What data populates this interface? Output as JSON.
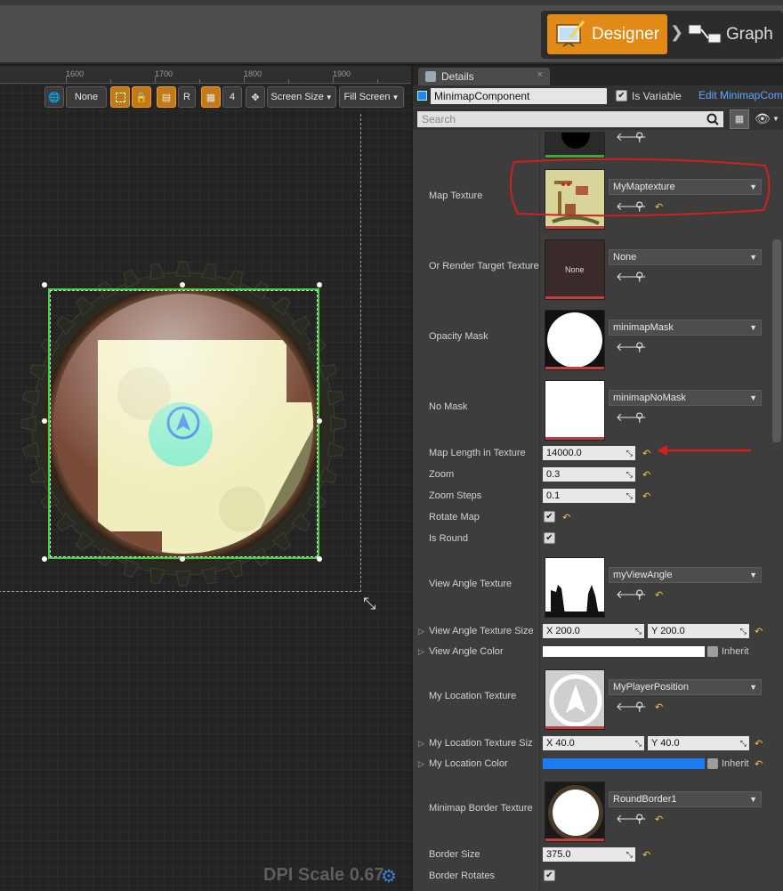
{
  "header": {
    "designer_label": "Designer",
    "graph_label": "Graph"
  },
  "ruler": {
    "ticks": [
      "1600",
      "1700",
      "1800",
      "1900"
    ]
  },
  "toolbar": {
    "none_label": "None",
    "r_label": "R",
    "grid_value": "4",
    "screen_size_label": "Screen Size",
    "fill_screen_label": "Fill Screen"
  },
  "canvas": {
    "dpi_label": "DPI Scale 0.67"
  },
  "details": {
    "tab_label": "Details",
    "tab_close": "×",
    "component_name": "MinimapComponent",
    "is_variable_label": "Is Variable",
    "edit_link": "Edit MinimapCom",
    "search_placeholder": "Search",
    "none_thumb_text": "None",
    "inherit_label": "Inherit",
    "properties": {
      "map_texture": {
        "label": "Map Texture",
        "value": "MyMaptexture"
      },
      "render_target": {
        "label": "Or Render Target Texture",
        "value": "None"
      },
      "opacity_mask": {
        "label": "Opacity Mask",
        "value": "minimapMask"
      },
      "no_mask": {
        "label": "No Mask",
        "value": "minimapNoMask"
      },
      "map_length": {
        "label": "Map Length in Texture",
        "value": "14000.0"
      },
      "zoom": {
        "label": "Zoom",
        "value": "0.3"
      },
      "zoom_steps": {
        "label": "Zoom Steps",
        "value": "0.1"
      },
      "rotate_map": {
        "label": "Rotate Map",
        "checked": true
      },
      "is_round": {
        "label": "Is Round",
        "checked": true
      },
      "view_angle_texture": {
        "label": "View Angle Texture",
        "value": "myViewAngle"
      },
      "view_angle_size": {
        "label": "View Angle Texture Size",
        "x": "X  200.0",
        "y": "Y  200.0"
      },
      "view_angle_color": {
        "label": "View Angle Color",
        "color": "#ffffff"
      },
      "my_location_texture": {
        "label": "My Location Texture",
        "value": "MyPlayerPosition"
      },
      "my_location_size": {
        "label": "My Location Texture Siz",
        "x": "X  40.0",
        "y": "Y  40.0"
      },
      "my_location_color": {
        "label": "My Location Color",
        "color": "#1e7cf2"
      },
      "border_texture": {
        "label": "Minimap Border Texture",
        "value": "RoundBorder1"
      },
      "border_size": {
        "label": "Border Size",
        "value": "375.0"
      },
      "border_rotates": {
        "label": "Border Rotates",
        "checked": true
      }
    }
  },
  "colors": {
    "accent_orange": "#e28a17",
    "selection_green": "#3ed33e",
    "annotation_red": "#d02020"
  }
}
